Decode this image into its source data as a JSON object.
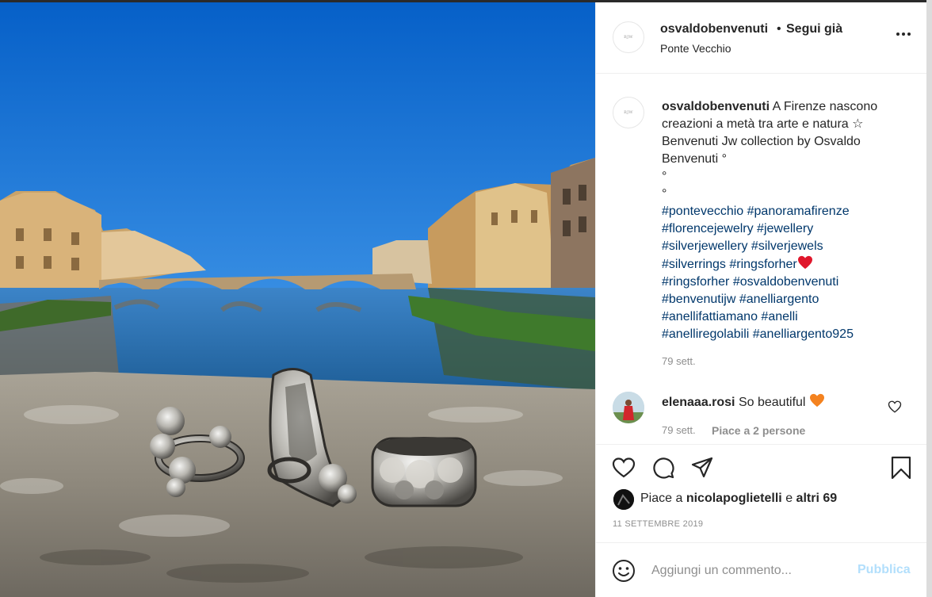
{
  "post": {
    "image_alt": "Anelli in argento su un parapetto davanti all'Arno e al Ponte Santa Trinita",
    "author": "osvaldobenvenuti",
    "follow_dot": "•",
    "follow_label": "Segui già",
    "location": "Ponte Vecchio",
    "logo_text": "BENVENUTI JW",
    "caption": {
      "username": "osvaldobenvenuti",
      "text_lines": [
        "A Firenze nascono",
        "creazioni a metà tra arte e natura ☆",
        "Benvenuti Jw collection by Osvaldo",
        "Benvenuti °",
        "°",
        "°"
      ],
      "hashtag_lines": [
        "#pontevecchio #panoramafirenze",
        "#florencejewelry #jewellery",
        "#silverjewellery #silverjewels",
        "#silverrings #ringsforher",
        "#ringsforher #osvaldobenvenuti",
        "#benvenutijw #anelliargento",
        "#anellifattiamano #anelli",
        "#anelliregolabili #anelliargento925"
      ],
      "time": "79 sett."
    },
    "comment": {
      "username": "elenaaa.rosi",
      "text": "So beautiful",
      "time": "79 sett.",
      "likes": "Piace a 2 persone"
    },
    "likes": {
      "prefix": "Piace a",
      "user": "nicolapoglietelli",
      "joiner": "e",
      "others": "altri 69"
    },
    "date": "11 SETTEMBRE 2019",
    "add_comment": {
      "placeholder": "Aggiungi un commento...",
      "publish": "Pubblica"
    }
  },
  "icons": [
    "more-icon",
    "heart-icon",
    "comment-icon",
    "share-icon",
    "bookmark-icon",
    "emoji-icon",
    "red-heart-emoji",
    "orange-heart-emoji"
  ],
  "colors": {
    "text": "#262626",
    "secondary": "#8e8e8e",
    "hashtag": "#00376b",
    "publish_disabled": "#b2dffc",
    "border": "#efefef"
  }
}
